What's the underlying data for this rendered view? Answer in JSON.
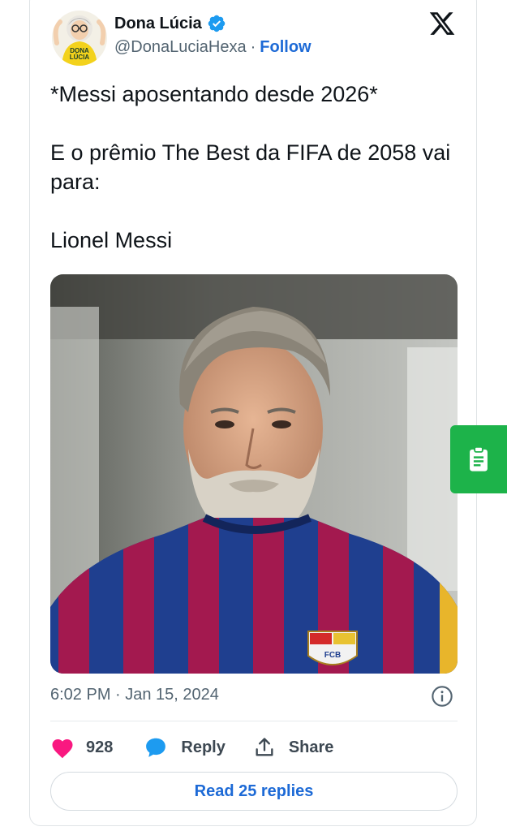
{
  "author": {
    "display_name": "Dona Lúcia",
    "handle": "@DonaLuciaHexa",
    "separator": "·",
    "follow_label": "Follow",
    "avatar_text_top": "DONA",
    "avatar_text_bottom": "LÚCIA"
  },
  "tweet": {
    "lines": [
      "*Messi aposentando desde 2026*",
      "E o prêmio The Best da FIFA de 2058 vai para:",
      "Lionel Messi"
    ],
    "timestamp": "6:02 PM · Jan 15, 2024",
    "crest_text": "FCB"
  },
  "actions": {
    "likes_count": "928",
    "reply_label": "Reply",
    "share_label": "Share"
  },
  "footer": {
    "read_replies_label": "Read 25 replies"
  },
  "colors": {
    "brand_blue": "#1d6ad6",
    "verified_blue": "#1d9bf0",
    "like_pink": "#f91880",
    "side_tab_green": "#1db34a"
  },
  "icons": {
    "verified": "verified-badge-icon",
    "platform": "x-logo-icon",
    "info": "info-icon",
    "like": "heart-icon",
    "reply": "speech-bubble-icon",
    "share": "share-upload-icon",
    "side_tab": "clipboard-icon"
  }
}
